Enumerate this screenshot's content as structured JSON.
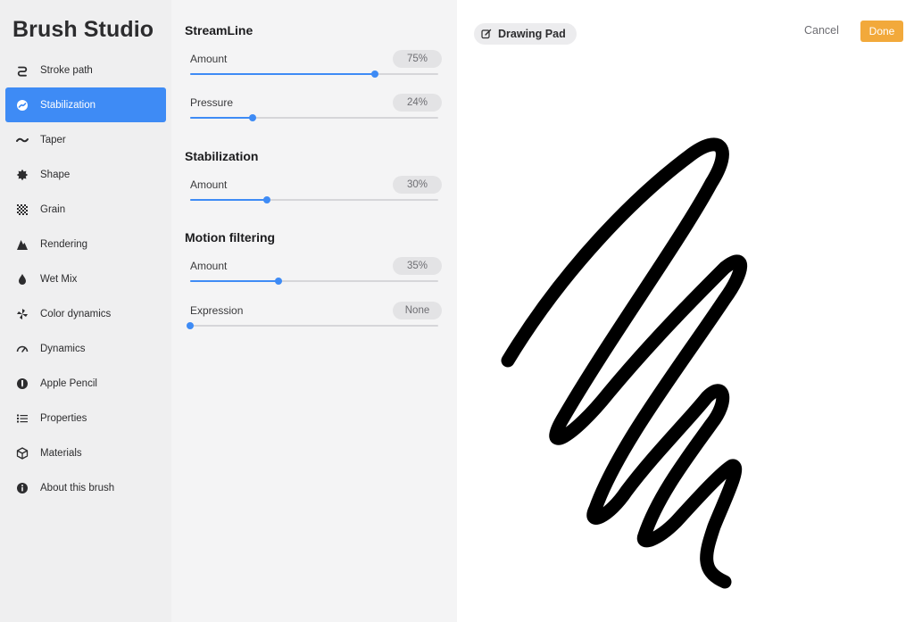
{
  "app": {
    "title": "Brush Studio"
  },
  "sidebar": {
    "items": [
      {
        "label": "Stroke path",
        "icon": "stroke-path-icon",
        "active": false
      },
      {
        "label": "Stabilization",
        "icon": "stabilization-icon",
        "active": true
      },
      {
        "label": "Taper",
        "icon": "taper-icon",
        "active": false
      },
      {
        "label": "Shape",
        "icon": "shape-icon",
        "active": false
      },
      {
        "label": "Grain",
        "icon": "grain-icon",
        "active": false
      },
      {
        "label": "Rendering",
        "icon": "rendering-icon",
        "active": false
      },
      {
        "label": "Wet Mix",
        "icon": "wet-mix-icon",
        "active": false
      },
      {
        "label": "Color dynamics",
        "icon": "color-dynamics-icon",
        "active": false
      },
      {
        "label": "Dynamics",
        "icon": "dynamics-icon",
        "active": false
      },
      {
        "label": "Apple Pencil",
        "icon": "apple-pencil-icon",
        "active": false
      },
      {
        "label": "Properties",
        "icon": "properties-icon",
        "active": false
      },
      {
        "label": "Materials",
        "icon": "materials-icon",
        "active": false
      },
      {
        "label": "About this brush",
        "icon": "info-icon",
        "active": false
      }
    ]
  },
  "settings": {
    "sections": [
      {
        "title": "StreamLine",
        "params": [
          {
            "label": "Amount",
            "value": "75%",
            "level": 0.745
          },
          {
            "label": "Pressure",
            "value": "24%",
            "level": 0.25
          }
        ]
      },
      {
        "title": "Stabilization",
        "params": [
          {
            "label": "Amount",
            "value": "30%",
            "level": 0.31
          }
        ]
      },
      {
        "title": "Motion filtering",
        "params": [
          {
            "label": "Amount",
            "value": "35%",
            "level": 0.355
          },
          {
            "label": "Expression",
            "value": "None",
            "level": 0
          }
        ]
      }
    ]
  },
  "pad": {
    "title": "Drawing Pad",
    "title_icon": "edit-icon",
    "cancel_label": "Cancel",
    "done_label": "Done"
  },
  "colors": {
    "accent": "#3e8bf5",
    "done": "#f2a93b",
    "sidebar_bg": "#efeff0",
    "panel_bg": "#f4f4f5",
    "stroke": "#000000"
  }
}
